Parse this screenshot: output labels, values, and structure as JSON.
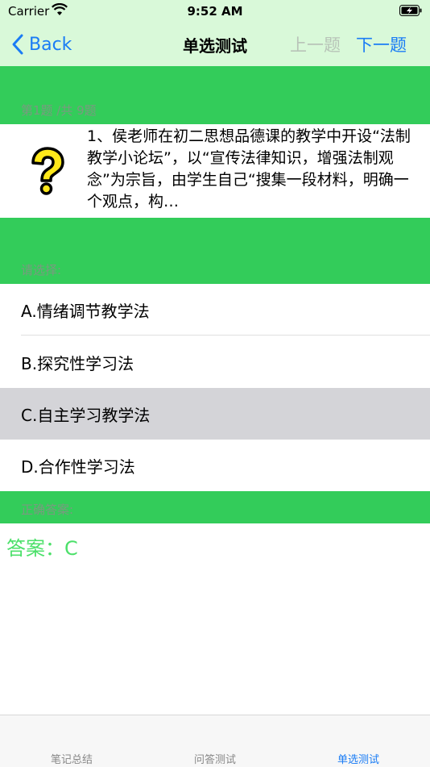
{
  "status_bar": {
    "carrier": "Carrier",
    "time": "9:52 AM"
  },
  "nav": {
    "back_label": "Back",
    "title": "单选测试",
    "prev_label": "上一题",
    "next_label": "下一题"
  },
  "question": {
    "counter": "第1题 /共 9题",
    "icon": "question-mark-icon",
    "text": "1、侯老师在初二思想品德课的教学中开设“法制教学小论坛”，以“宣传法律知识，增强法制观念”为宗旨，由学生自己“搜集一段材料，明确一个观点，构…"
  },
  "options_section": {
    "prompt": "请选择:",
    "options": [
      {
        "label": "A.情绪调节教学法"
      },
      {
        "label": "B.探究性学习法"
      },
      {
        "label": "C.自主学习教学法"
      },
      {
        "label": "D.合作性学习法"
      }
    ],
    "selected_index": 2
  },
  "answer_section": {
    "heading": "正确答案:",
    "answer": "答案：C"
  },
  "tab_bar": {
    "tabs": [
      {
        "label": "笔记总结"
      },
      {
        "label": "问答测试"
      },
      {
        "label": "单选测试"
      }
    ],
    "active_index": 2
  },
  "colors": {
    "nav_background": "#d9f9d9",
    "band_green": "#33cc5a",
    "accent_blue": "#1a7cf5",
    "answer_green": "#4ce06a",
    "selected_gray": "#d4d4d8"
  }
}
